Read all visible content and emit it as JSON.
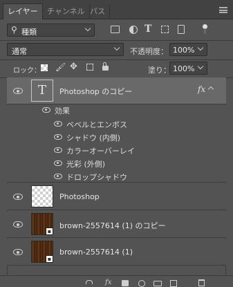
{
  "tabs": [
    {
      "label": "レイヤー",
      "active": true
    },
    {
      "label": "チャンネル",
      "active": false
    },
    {
      "label": "パス",
      "active": false
    }
  ],
  "filter": {
    "kind_label": "種類"
  },
  "blend": {
    "mode": "通常",
    "opacity_label": "不透明度：",
    "opacity_value": "100%"
  },
  "lock": {
    "label": "ロック：",
    "fill_label": "塗り：",
    "fill_value": "100%"
  },
  "layers": [
    {
      "name": "Photoshop のコピー",
      "type": "text",
      "selected": true,
      "fx": "fx"
    },
    {
      "name": "Photoshop",
      "type": "transparent"
    },
    {
      "name": "brown-2557614 (1) のコピー",
      "type": "image"
    },
    {
      "name": "brown-2557614 (1)",
      "type": "image"
    }
  ],
  "effects": {
    "header": "効果",
    "items": [
      "ベベルとエンボス",
      "シャドウ (内側)",
      "カラーオーバーレイ",
      "光彩 (外側)",
      "ドロップシャドウ"
    ]
  },
  "icons": {
    "text_thumb": "T"
  }
}
